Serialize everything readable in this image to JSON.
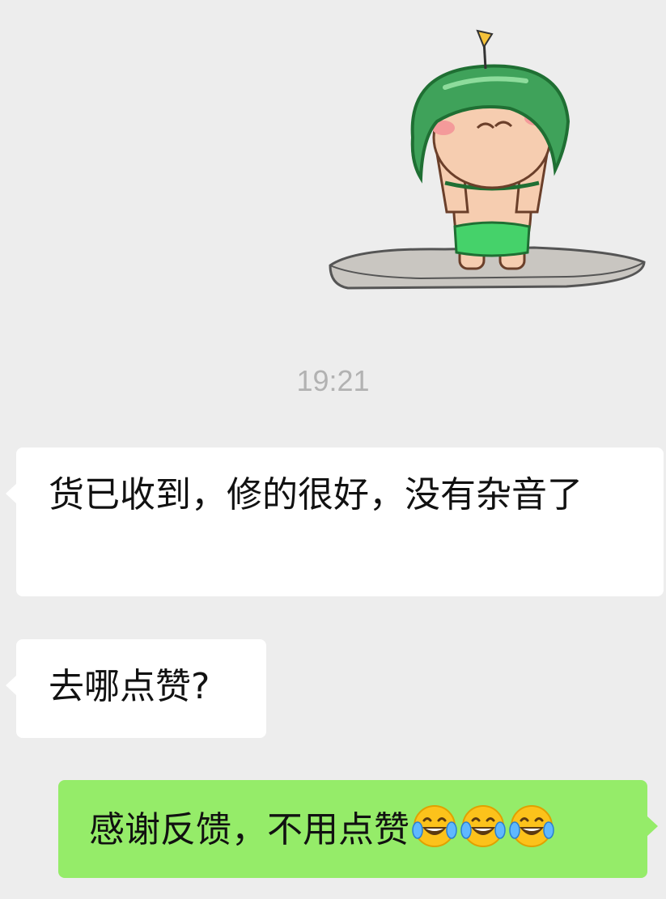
{
  "timestamp": "19:21",
  "sticker": {
    "icon": "soldier-helmet-sticker"
  },
  "messages": [
    {
      "direction": "incoming",
      "text": "货已收到，修的很好，没有杂音了"
    },
    {
      "direction": "incoming",
      "text": "去哪点赞?"
    },
    {
      "direction": "outgoing",
      "text": "感谢反馈，不用点赞",
      "emojis": [
        "tears-of-joy-emoji",
        "tears-of-joy-emoji",
        "tears-of-joy-emoji"
      ]
    }
  ],
  "colors": {
    "background": "#ededed",
    "incoming_bubble": "#ffffff",
    "outgoing_bubble": "#95ec69",
    "timestamp": "#b2b2b2",
    "text": "#111111"
  }
}
